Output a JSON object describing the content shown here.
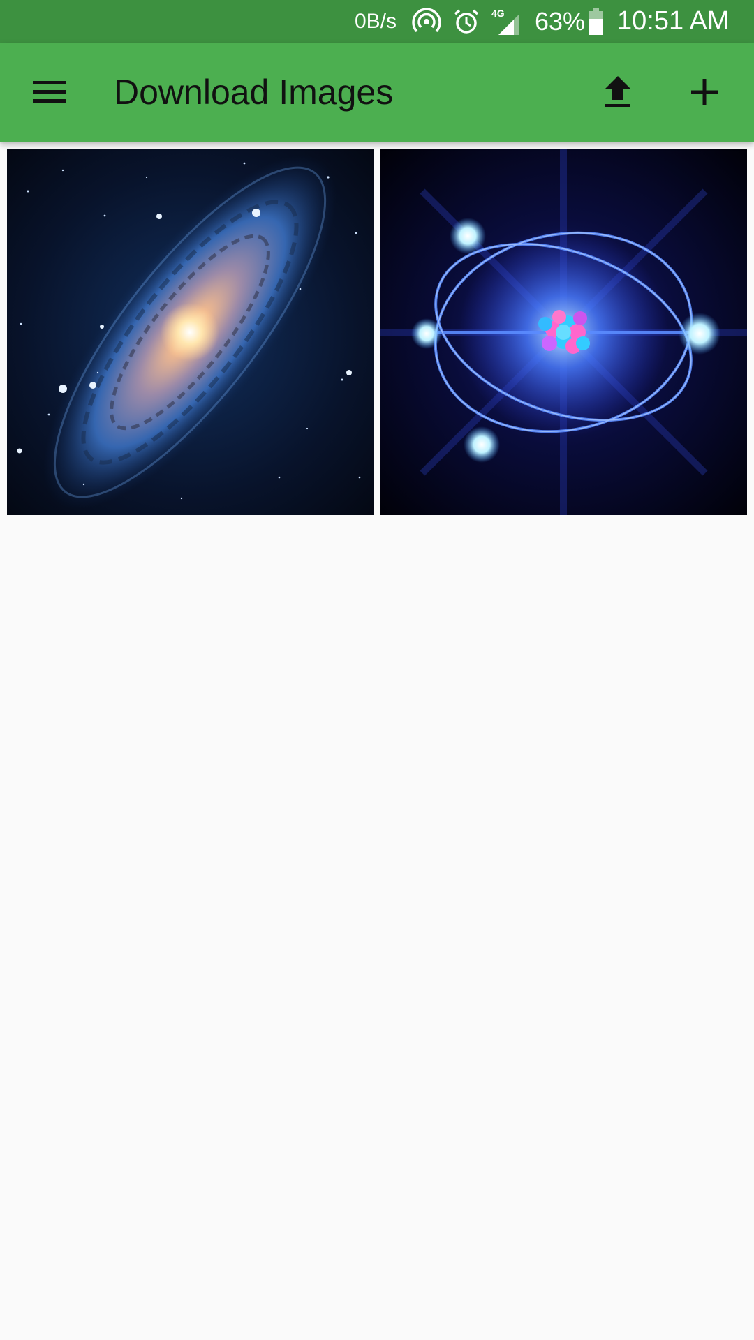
{
  "status_bar": {
    "network_speed": "0B/s",
    "network_type": "4G",
    "battery_percent": "63%",
    "time": "10:51 AM",
    "icons": [
      "hotspot-icon",
      "alarm-icon",
      "signal-4g-icon",
      "battery-icon"
    ]
  },
  "toolbar": {
    "title": "Download Images",
    "actions": [
      "menu-icon",
      "upload-icon",
      "add-icon"
    ]
  },
  "colors": {
    "status_bar": "#3D9140",
    "toolbar": "#4CAF50",
    "background": "#FAFAFA"
  },
  "gallery": {
    "images": [
      {
        "name": "galaxy-image"
      },
      {
        "name": "atom-image"
      }
    ]
  }
}
